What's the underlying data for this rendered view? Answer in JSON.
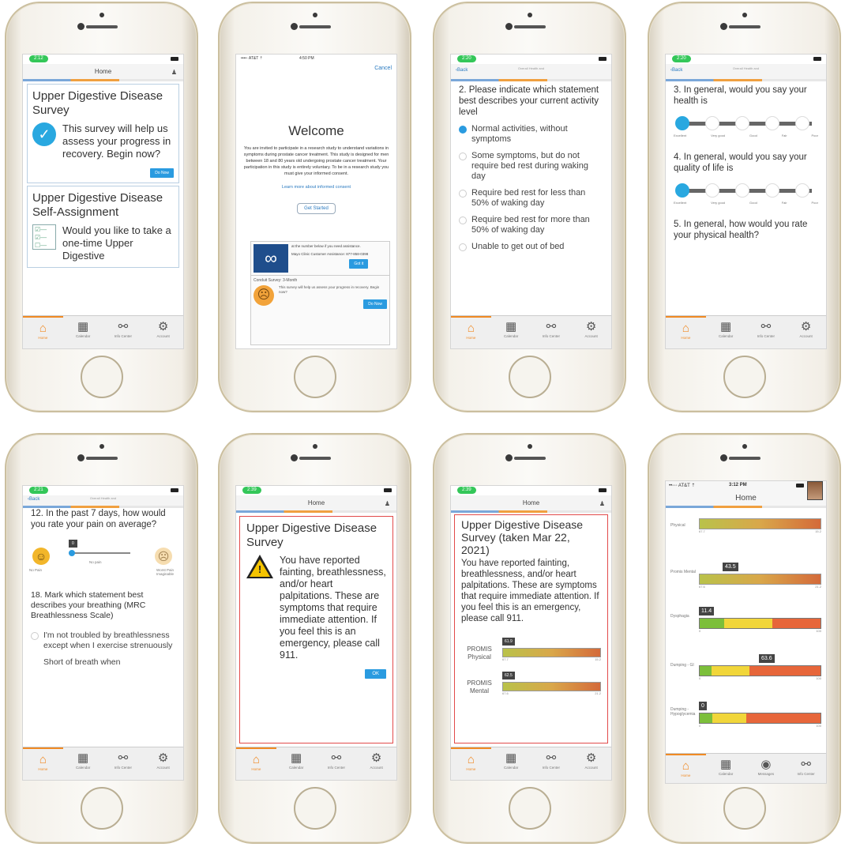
{
  "screens": {
    "p1": {
      "status_time": "2:12",
      "nav_title": "Home",
      "card1": {
        "title": "Upper Digestive Disease Survey",
        "text": "This survey will help us assess your progress in recovery. Begin now?",
        "button": "Do Now"
      },
      "card2": {
        "title": "Upper Digestive Disease Self-Assignment",
        "text": "Would you like to take a one-time Upper Digestive"
      }
    },
    "p2": {
      "status": "••••◦ AT&T ⇡",
      "time": "4:50 PM",
      "cancel": "Cancel",
      "heading": "Welcome",
      "body": "You are invited to participate in a research study to understand variations in symptoms during prostate cancer treatment. This study is designed for men between 18 and 80 years old undergoing prostate cancer treatment. Your participation in this study is entirely voluntary. To be in a research study you must give your informed consent.",
      "learn_more": "Learn more about informed consent",
      "get_started": "Get Started",
      "card_text": "at the number below if you need assistance.",
      "card_phone": "Mayo Clinic Customer Assistance: 877-858-0398",
      "got_it": "Got it",
      "survey_title": "Conduit Survey: 3-Month",
      "survey_text": "This survey will help us assess your progress in recovery. Begin now?",
      "do_now": "Do Now"
    },
    "p3": {
      "status_time": "2:20",
      "back": "Back",
      "nav_sub": "Overall Health and",
      "question": "2. Please indicate which statement best describes your current activity level",
      "options": [
        "Normal activities, without symptoms",
        "Some symptoms, but do not require bed rest during waking day",
        "Require bed rest for less than 50% of waking day",
        "Require bed rest for more than 50% of waking day",
        "Unable to get out of bed"
      ]
    },
    "p4": {
      "status_time": "2:20",
      "back": "Back",
      "nav_sub": "Overall Health and",
      "q3": "3. In general, would you say your health is",
      "q4": "4. In general, would you say your quality of life is",
      "q5": "5. In general, how would you rate your physical health?",
      "scale_labels": [
        "Excellent",
        "Very good",
        "Good",
        "Fair",
        "Poor"
      ]
    },
    "p5": {
      "status_time": "2:21",
      "back": "Back",
      "nav_sub": "Overall Health and",
      "q12": "12. In the past 7 days, how would you rate your pain on average?",
      "slider_value": "0",
      "no_pain": "No Pain",
      "no_pain_mid": "No pain",
      "worst": "Worst Pain Imaginable",
      "q18": "18. Mark which statement best describes your breathing (MRC Breathlessness Scale)",
      "opt1": "I'm not troubled by breathlessness except when I exercise strenuously",
      "opt2": "Short of breath when"
    },
    "p6": {
      "status_time": "2:39",
      "nav_title": "Home",
      "title": "Upper Digestive Disease Survey",
      "text": "You have reported fainting, breathlessness, and/or heart palpitations. These are symptoms that require immediate attention. If you feel this is an emergency, please call 911.",
      "ok": "OK"
    },
    "p7": {
      "status_time": "2:39",
      "nav_title": "Home",
      "title": "Upper Digestive Disease Survey (taken Mar 22, 2021)",
      "text": "You have reported fainting, breathlessness, and/or heart palpitations. These are symptoms that require immediate attention. If you feel this is an emergency, please call 911.",
      "bars": [
        {
          "label": "PROMIS Physical",
          "value": "61.9",
          "min": "67.7",
          "max": "15.2"
        },
        {
          "label": "PROMIS Mental",
          "value": "62.5",
          "min": "67.6",
          "max": "21.2"
        }
      ]
    },
    "p8": {
      "status": "••◦◦◦ AT&T ⇡",
      "time": "3:12 PM",
      "nav_title": "Home",
      "bars": [
        {
          "label": "Physical",
          "value": "",
          "min": "67.7",
          "max": "15.2"
        },
        {
          "label": "Promis Mental",
          "value": "43.5",
          "min": "67.6",
          "max": "21.2"
        },
        {
          "label": "Dysphagia",
          "value": "11.4",
          "min": "0",
          "max": "100"
        },
        {
          "label": "Dumping - GI",
          "value": "63.6",
          "min": "0",
          "max": "100"
        },
        {
          "label": "Dumping - Hypoglycemia",
          "value": "0",
          "min": "0",
          "max": "100"
        }
      ]
    }
  },
  "tabs": [
    "Home",
    "Calendar",
    "Info Center",
    "Account"
  ],
  "tabs_p8": [
    "Home",
    "Calendar",
    "Messages",
    "Info Center"
  ],
  "colors": {
    "accent": "#f08a24",
    "blue": "#2a9be0",
    "alert": "#e24a4a"
  }
}
